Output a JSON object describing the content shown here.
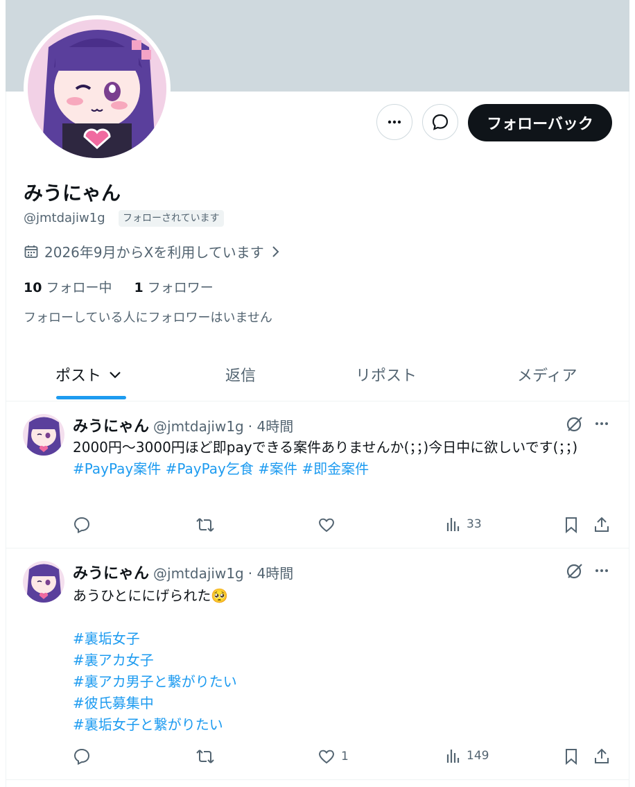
{
  "profile": {
    "name": "みうにゃん",
    "handle": "@jmtdajiw1g",
    "followed_badge": "フォローされています",
    "joined": "2026年9月からXを利用しています",
    "following_count": "10",
    "following_label": "フォロー中",
    "followers_count": "1",
    "followers_label": "フォロワー",
    "mutual_note": "フォローしている人にフォロワーはいません",
    "follow_back_label": "フォローバック"
  },
  "tabs": [
    {
      "label": "ポスト"
    },
    {
      "label": "返信"
    },
    {
      "label": "リポスト"
    },
    {
      "label": "メディア"
    }
  ],
  "posts": [
    {
      "name": "みうにゃん",
      "handle": "@jmtdajiw1g",
      "time": "· 4時間",
      "text1": "2000円～3000円ほど即payできる案件ありませんか(；；)今日中に欲しいです(；；)",
      "text2": "#PayPay案件 #PayPay乞食 #案件 #即金案件",
      "likes": "",
      "views": "33"
    },
    {
      "name": "みうにゃん",
      "handle": "@jmtdajiw1g",
      "time": "· 4時間",
      "text1": "あうひとににげられた🥺",
      "tags": [
        "#裏垢女子",
        "#裏アカ女子",
        "#裏アカ男子と繋がりたい",
        "#彼氏募集中",
        "#裏垢女子と繋がりたい"
      ],
      "likes": "1",
      "views": "149"
    }
  ],
  "colors": {
    "accent": "#1d9bf0",
    "banner": "#cfd9de",
    "text": "#0f1419",
    "muted": "#536471"
  },
  "icons": [
    "more-icon",
    "message-icon",
    "calendar-icon",
    "chevron-right-icon",
    "chevron-down-icon",
    "reply-icon",
    "repost-icon",
    "like-icon",
    "views-icon",
    "bookmark-icon",
    "share-icon",
    "grok-icon"
  ]
}
